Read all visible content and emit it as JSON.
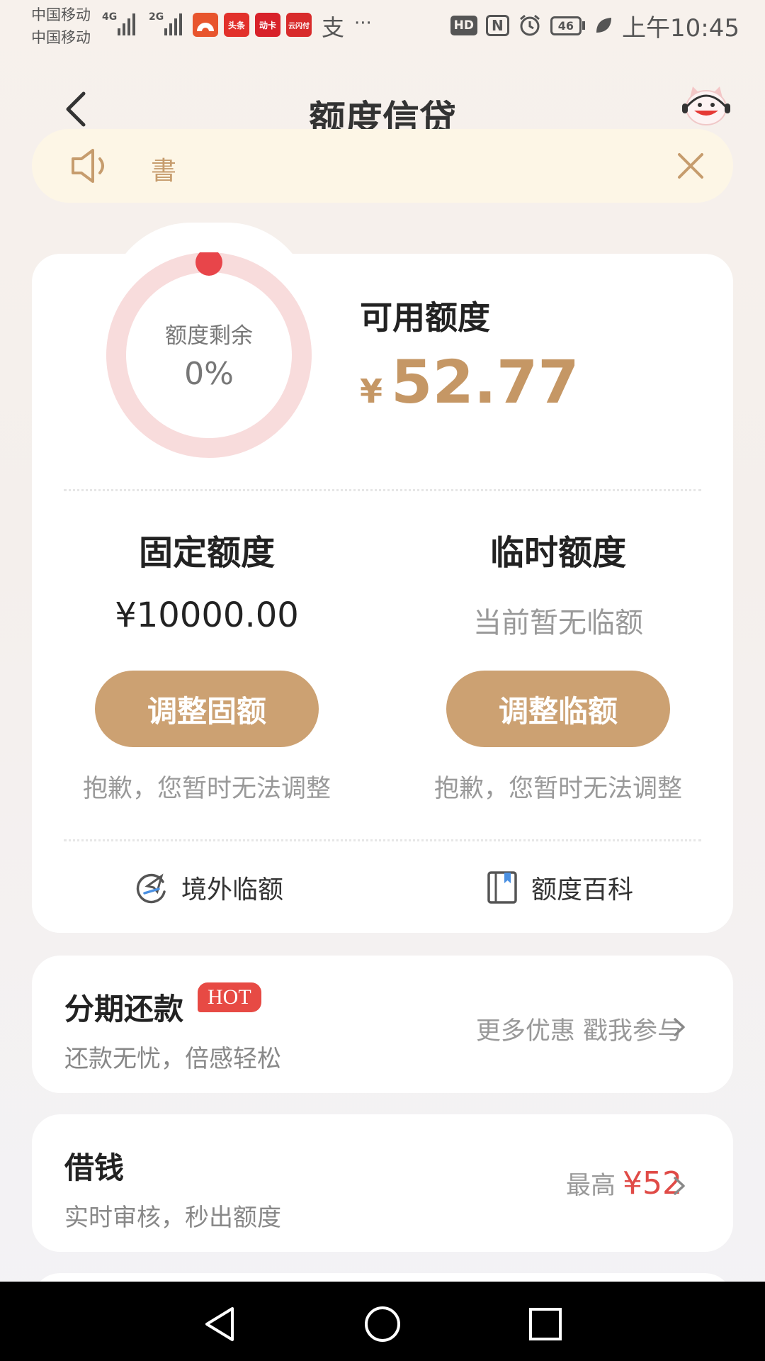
{
  "status_bar": {
    "carrier1": "中国移动",
    "carrier2": "中国移动",
    "net1": "4G",
    "net2": "2G",
    "apps": [
      {
        "label": "",
        "color": "#e8552d"
      },
      {
        "label": "头条",
        "color": "#e2312b"
      },
      {
        "label": "动卡",
        "color": "#d8222a"
      },
      {
        "label": "云闪付",
        "color": "#d82b2b"
      }
    ],
    "alipay_glyph": "支",
    "more": "···",
    "hd": "HD",
    "nfc": "N",
    "battery": "46",
    "time": "上午10:45"
  },
  "header": {
    "title": "额度信贷"
  },
  "notice": {
    "text": "書"
  },
  "credit": {
    "ring_label": "额度剩余",
    "ring_value": "0%",
    "ring_fraction": 0.0,
    "available_label": "可用额度",
    "currency": "¥",
    "available_amount": "52.77",
    "fixed_title": "固定额度",
    "fixed_value": "¥10000.00",
    "temp_title": "临时额度",
    "temp_value": "当前暂无临额",
    "adjust_fixed": "调整固额",
    "adjust_temp": "调整临额",
    "sorry_fixed": "抱歉，您暂时无法调整",
    "sorry_temp": "抱歉，您暂时无法调整",
    "link_overseas": "境外临额",
    "link_wiki": "额度百科"
  },
  "installment": {
    "title": "分期还款",
    "badge": "HOT",
    "subtitle": "还款无忧，倍感轻松",
    "right_text": "更多优惠 戳我参与"
  },
  "loan": {
    "title": "借钱",
    "subtitle": "实时审核，秒出额度",
    "right_prefix": "最高",
    "right_amount": "¥52"
  },
  "colors": {
    "accent": "#cca172",
    "amount": "#c59765",
    "ring": "#f8d8d8",
    "ring_dot": "#e8454a",
    "hot": "#e74a44"
  }
}
